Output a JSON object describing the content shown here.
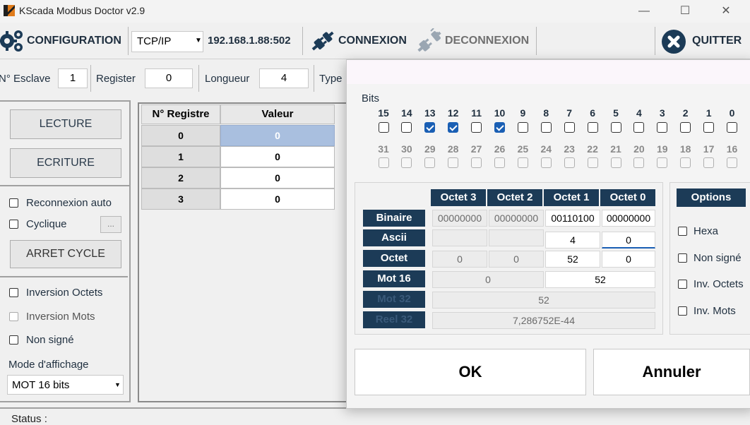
{
  "window": {
    "title": "KScada Modbus Doctor v2.9",
    "minimize": "—",
    "maximize": "☐",
    "close": "✕"
  },
  "toolbar": {
    "configuration_label": "CONFIGURATION",
    "protocol": "TCP/IP",
    "address": "192.168.1.88:502",
    "connexion_label": "CONNEXION",
    "deconnexion_label": "DECONNEXION",
    "quit_label": "QUITTER"
  },
  "params": {
    "slave_label": "N° Esclave",
    "slave_value": "1",
    "register_label": "Register",
    "register_value": "0",
    "length_label": "Longueur",
    "length_value": "4",
    "type_label": "Type"
  },
  "left_panel": {
    "read_button": "LECTURE",
    "write_button": "ECRITURE",
    "auto_reconnect": "Reconnexion auto",
    "cyclic": "Cyclique",
    "cycle_settings": "...",
    "stop_cycle": "ARRET CYCLE",
    "invert_bytes": "Inversion Octets",
    "invert_words": "Inversion Mots",
    "unsigned": "Non signé",
    "display_mode_label": "Mode d'affichage",
    "display_mode_value": "MOT 16 bits"
  },
  "register_table": {
    "headers": [
      "N° Registre",
      "Valeur"
    ],
    "rows": [
      {
        "register": "0",
        "value": "0"
      },
      {
        "register": "1",
        "value": "0"
      },
      {
        "register": "2",
        "value": "0"
      },
      {
        "register": "3",
        "value": "0"
      }
    ]
  },
  "status": {
    "label": "Status :"
  },
  "dialog": {
    "bits_label": "Bits",
    "bits_row1": [
      "15",
      "14",
      "13",
      "12",
      "11",
      "10",
      "9",
      "8",
      "7",
      "6",
      "5",
      "4",
      "3",
      "2",
      "1",
      "0"
    ],
    "bits_row1_checked": [
      false,
      false,
      true,
      true,
      false,
      true,
      false,
      false,
      false,
      false,
      false,
      false,
      false,
      false,
      false,
      false
    ],
    "bits_row2": [
      "31",
      "30",
      "29",
      "28",
      "27",
      "26",
      "25",
      "24",
      "23",
      "22",
      "21",
      "20",
      "19",
      "18",
      "17",
      "16"
    ],
    "octet_headers": [
      "Octet 3",
      "Octet 2",
      "Octet 1",
      "Octet 0"
    ],
    "row_labels": [
      "Binaire",
      "Ascii",
      "Octet",
      "Mot 16",
      "Mot 32",
      "Reel 32"
    ],
    "binaire": [
      "00000000",
      "00000000",
      "00110100",
      "00000000"
    ],
    "ascii": [
      "",
      "",
      "4",
      "0"
    ],
    "octet": [
      "0",
      "0",
      "52",
      "0"
    ],
    "mot16": [
      "0",
      "52"
    ],
    "mot32": "52",
    "reel32": "7,286752E-44",
    "options_label": "Options",
    "options": [
      "Hexa",
      "Non signé",
      "Inv. Octets",
      "Inv. Mots"
    ],
    "ok_button": "OK",
    "cancel_button": "Annuler"
  },
  "colors": {
    "navy": "#1c3b57",
    "selection": "#a9bfdf",
    "highlight": "#ffff40",
    "checked_blue": "#1a5fb4"
  }
}
